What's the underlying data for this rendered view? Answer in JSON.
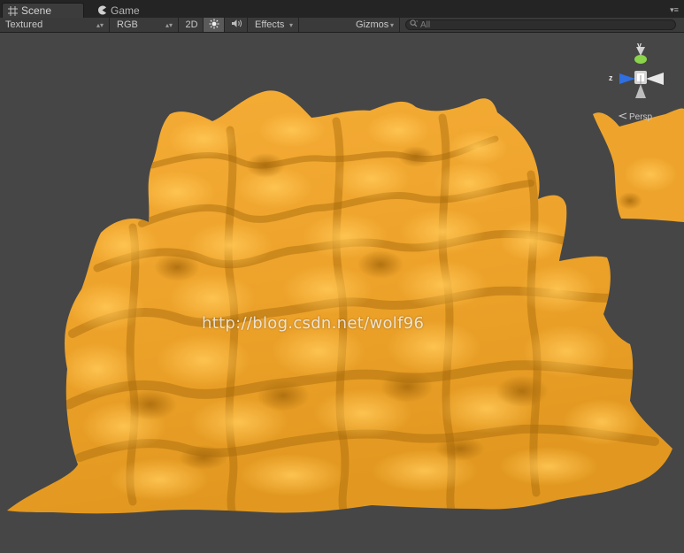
{
  "tabs": [
    {
      "label": "Scene",
      "icon": "scene-grid-icon",
      "active": true
    },
    {
      "label": "Game",
      "icon": "game-pacman-icon",
      "active": false
    }
  ],
  "toolbar": {
    "shading_mode": "Textured",
    "render_mode": "RGB",
    "mode_2d": "2D",
    "lighting_icon": "sun-icon",
    "audio_icon": "speaker-icon",
    "effects_label": "Effects",
    "gizmos_label": "Gizmos",
    "search_placeholder": "All"
  },
  "gizmo": {
    "y_label": "y",
    "z_label": "z",
    "projection_label": "Persp",
    "colors": {
      "y_axis": "#8ad34a",
      "z_axis": "#2f6fe0",
      "x_axis": "#e8e8e8"
    }
  },
  "watermark": "http://blog.csdn.net/wolf96",
  "colors": {
    "viewport_background": "#464646",
    "terrain": "#f2a42d",
    "terrain_shadow": "#b77710",
    "terrain_highlight": "#ffc24e"
  }
}
